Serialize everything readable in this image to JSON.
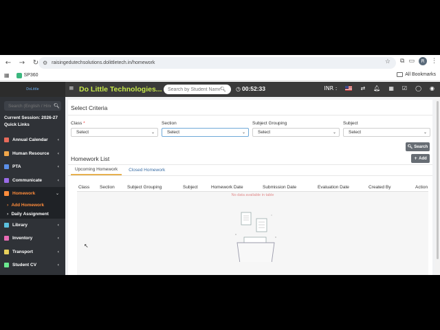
{
  "browser": {
    "url": "raisingedutechsolutions.dolittletech.in/homework",
    "bookmark": "SP360",
    "all_bookmarks": "All Bookmarks",
    "profile_initial": "R"
  },
  "header": {
    "brand": "Do Little Technologies...",
    "brand_logo": "DoLittle",
    "student_search_placeholder": "Search by Student Name",
    "timer": "00:52:33",
    "currency": "INR :"
  },
  "sidebar": {
    "search_placeholder": "Search (English / Hindi)",
    "session": "Current Session: 2026-27",
    "quick_links": "Quick Links",
    "items": [
      {
        "label": "Annual Calendar",
        "color": "#e86b5b"
      },
      {
        "label": "Human Resource",
        "color": "#f0a64a"
      },
      {
        "label": "PTA",
        "color": "#5b8fe8"
      },
      {
        "label": "Communicate",
        "color": "#9b6be8"
      },
      {
        "label": "Homework",
        "color": "#ff8c3b"
      }
    ],
    "sub_items": [
      {
        "label": "Add Homework"
      },
      {
        "label": "Daily Assignment"
      }
    ],
    "items_after": [
      {
        "label": "Library",
        "color": "#5bc0de"
      },
      {
        "label": "Inventory",
        "color": "#e86bb5"
      },
      {
        "label": "Transport",
        "color": "#e8d05b"
      },
      {
        "label": "Student CV",
        "color": "#6be88f"
      }
    ]
  },
  "criteria": {
    "title": "Select Criteria",
    "fields": [
      {
        "label": "Class",
        "required": "*",
        "value": "Select"
      },
      {
        "label": "Section",
        "value": "Select"
      },
      {
        "label": "Subject Grouping",
        "value": "Select"
      },
      {
        "label": "Subject",
        "value": "Select"
      }
    ],
    "search_button": "Search"
  },
  "homework_list": {
    "title": "Homework List",
    "add_button": "Add",
    "tabs": [
      "Upcoming Homework",
      "Closed Homework"
    ],
    "columns": [
      "Class",
      "Section",
      "Subject Grouping",
      "Subject",
      "Homework Date",
      "Submission Date",
      "Evaluation Date",
      "Created By",
      "Action"
    ],
    "empty_message": "No data available in table"
  }
}
